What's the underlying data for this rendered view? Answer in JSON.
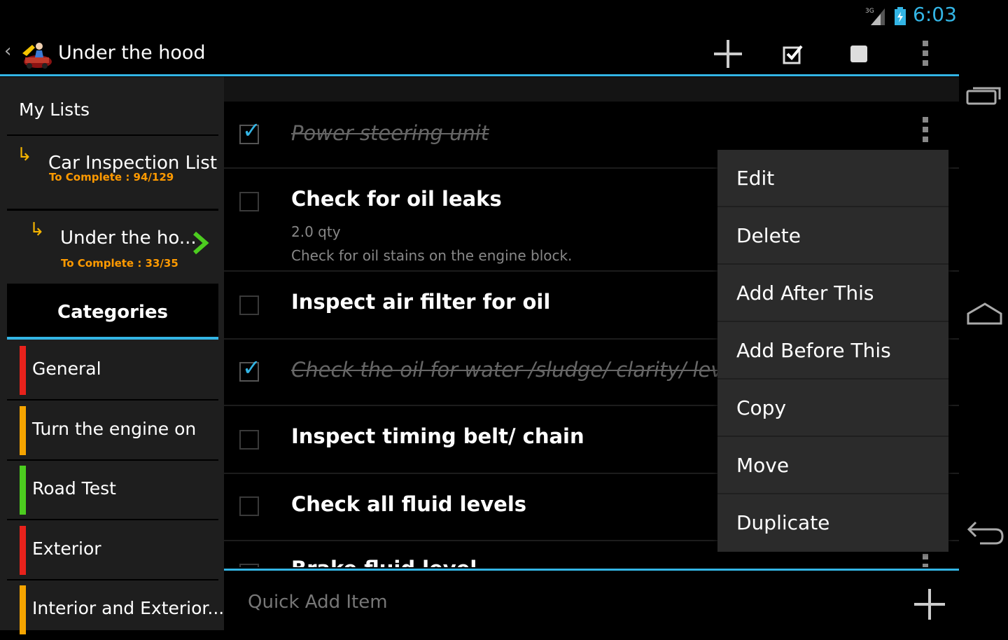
{
  "status": {
    "time": "6:03",
    "network": "3G"
  },
  "actionbar": {
    "title": "Under the hood"
  },
  "sidebar": {
    "header": "My Lists",
    "lists": [
      {
        "name": "Car Inspection List",
        "progress": "To Complete : 94/129"
      },
      {
        "name": "Under the ho...",
        "progress": "To Complete : 33/35"
      }
    ],
    "categories_header": "Categories",
    "categories": [
      {
        "name": "General",
        "color": "#e8221c"
      },
      {
        "name": "Turn the engine on",
        "color": "#f5a400"
      },
      {
        "name": "Road Test",
        "color": "#4ccc1f"
      },
      {
        "name": "Exterior",
        "color": "#e8221c"
      },
      {
        "name": "Interior and Exterior...",
        "color": "#f5a400"
      }
    ]
  },
  "items": [
    {
      "title": "Power steering unit",
      "checked": true
    },
    {
      "title": "Check for oil leaks",
      "qty": "2.0 qty",
      "note": "Check for oil stains on the engine block.",
      "checked": false
    },
    {
      "title": "Inspect air filter for oil",
      "checked": false
    },
    {
      "title": "Check the oil for water /sludge/ clarity/ level",
      "checked": true
    },
    {
      "title": "Inspect timing belt/ chain",
      "checked": false
    },
    {
      "title": "Check all fluid levels",
      "checked": false
    },
    {
      "title": "Brake fluid level",
      "checked": false
    }
  ],
  "context_menu": [
    "Edit",
    "Delete",
    "Add After This",
    "Add Before This",
    "Copy",
    "Move",
    "Duplicate"
  ],
  "quick_add": {
    "placeholder": "Quick Add Item"
  },
  "colors": {
    "accent": "#33b5e5",
    "progress": "#ff9a00",
    "list_arrow": "#f5b400",
    "next_arrow": "#4ccc1f"
  }
}
